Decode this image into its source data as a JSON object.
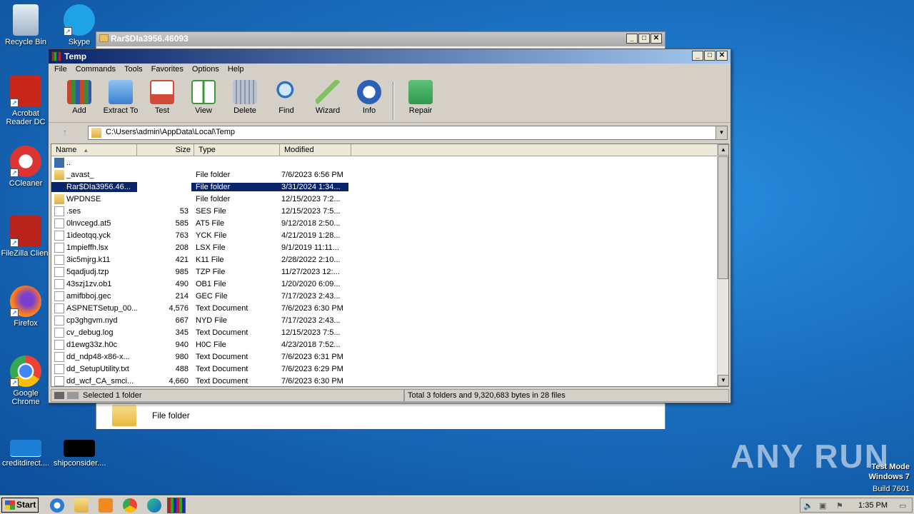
{
  "desktop": {
    "icons": [
      {
        "label": "Recycle Bin",
        "icon": "recycle-bin-icon"
      },
      {
        "label": "Skype",
        "icon": "skype-icon"
      },
      {
        "label": "Acrobat Reader DC",
        "icon": "acrobat-icon"
      },
      {
        "label": "CCleaner",
        "icon": "ccleaner-icon"
      },
      {
        "label": "FileZilla Client",
        "icon": "filezilla-icon"
      },
      {
        "label": "Firefox",
        "icon": "firefox-icon"
      },
      {
        "label": "Google Chrome",
        "icon": "chrome-icon"
      },
      {
        "label": "creditdirect....",
        "icon": "file-icon"
      },
      {
        "label": "shipconsider....",
        "icon": "file-icon"
      }
    ],
    "watermark": "ANY RUN",
    "test_mode": {
      "line1": "Test Mode",
      "line2": "Windows 7",
      "line3": "Build 7601"
    }
  },
  "background_window": {
    "title": "Rar$DIa3956.46093",
    "bottom_item_label": "File folder"
  },
  "main_window": {
    "title": "Temp",
    "menu": [
      "File",
      "Commands",
      "Tools",
      "Favorites",
      "Options",
      "Help"
    ],
    "toolbar": [
      {
        "label": "Add",
        "icon": "add-archive-icon",
        "color": "#c8442a"
      },
      {
        "label": "Extract To",
        "icon": "extract-folder-icon",
        "color": "#3a7fd0"
      },
      {
        "label": "Test",
        "icon": "test-clipboard-icon",
        "color": "#d24a3a"
      },
      {
        "label": "View",
        "icon": "view-book-icon",
        "color": "#3a9a3a"
      },
      {
        "label": "Delete",
        "icon": "trash-icon",
        "color": "#8a95a8"
      },
      {
        "label": "Find",
        "icon": "find-magnifier-icon",
        "color": "#2f6fc0"
      },
      {
        "label": "Wizard",
        "icon": "wizard-wand-icon",
        "color": "#7fc060"
      },
      {
        "label": "Info",
        "icon": "info-icon",
        "color": "#2a60b8"
      },
      {
        "label": "Repair",
        "icon": "repair-kit-icon",
        "color": "#2f9a4a"
      }
    ],
    "address": "C:\\Users\\admin\\AppData\\Local\\Temp",
    "columns": {
      "name": "Name",
      "size": "Size",
      "type": "Type",
      "modified": "Modified"
    },
    "rows": [
      {
        "name": "..",
        "size": "",
        "type": "",
        "modified": "",
        "kind": "up"
      },
      {
        "name": "_avast_",
        "size": "",
        "type": "File folder",
        "modified": "7/6/2023 6:56 PM",
        "kind": "folder"
      },
      {
        "name": "Rar$DIa3956.46...",
        "size": "",
        "type": "File folder",
        "modified": "3/31/2024 1:34...",
        "kind": "rar",
        "selected": true
      },
      {
        "name": "WPDNSE",
        "size": "",
        "type": "File folder",
        "modified": "12/15/2023 7:2...",
        "kind": "folder"
      },
      {
        "name": ".ses",
        "size": "53",
        "type": "SES File",
        "modified": "12/15/2023 7:5...",
        "kind": "file"
      },
      {
        "name": "0lnvcegd.at5",
        "size": "585",
        "type": "AT5 File",
        "modified": "9/12/2018 2:50...",
        "kind": "file"
      },
      {
        "name": "1ideotqq.yck",
        "size": "763",
        "type": "YCK File",
        "modified": "4/21/2019 1:28...",
        "kind": "file"
      },
      {
        "name": "1mpieffh.lsx",
        "size": "208",
        "type": "LSX File",
        "modified": "9/1/2019 11:11...",
        "kind": "file"
      },
      {
        "name": "3ic5mjrg.k11",
        "size": "421",
        "type": "K11 File",
        "modified": "2/28/2022 2:10...",
        "kind": "file"
      },
      {
        "name": "5qadjudj.tzp",
        "size": "985",
        "type": "TZP File",
        "modified": "11/27/2023 12:...",
        "kind": "file"
      },
      {
        "name": "43szj1zv.ob1",
        "size": "490",
        "type": "OB1 File",
        "modified": "1/20/2020 6:09...",
        "kind": "file"
      },
      {
        "name": "amifbboj.gec",
        "size": "214",
        "type": "GEC File",
        "modified": "7/17/2023 2:43...",
        "kind": "file"
      },
      {
        "name": "ASPNETSetup_00...",
        "size": "4,576",
        "type": "Text Document",
        "modified": "7/6/2023 6:30 PM",
        "kind": "file"
      },
      {
        "name": "cp3ghgvm.nyd",
        "size": "667",
        "type": "NYD File",
        "modified": "7/17/2023 2:43...",
        "kind": "file"
      },
      {
        "name": "cv_debug.log",
        "size": "345",
        "type": "Text Document",
        "modified": "12/15/2023 7:5...",
        "kind": "file"
      },
      {
        "name": "d1ewg33z.h0c",
        "size": "940",
        "type": "H0C File",
        "modified": "4/23/2018 7:52...",
        "kind": "file"
      },
      {
        "name": "dd_ndp48-x86-x...",
        "size": "980",
        "type": "Text Document",
        "modified": "7/6/2023 6:31 PM",
        "kind": "file"
      },
      {
        "name": "dd_SetupUtility.txt",
        "size": "488",
        "type": "Text Document",
        "modified": "7/6/2023 6:29 PM",
        "kind": "file"
      },
      {
        "name": "dd_wcf_CA_smci...",
        "size": "4,660",
        "type": "Text Document",
        "modified": "7/6/2023 6:30 PM",
        "kind": "file"
      }
    ],
    "status_left": "Selected 1 folder",
    "status_right": "Total 3 folders and 9,320,683 bytes in 28 files"
  },
  "taskbar": {
    "start_label": "Start",
    "clock": "1:35 PM"
  }
}
